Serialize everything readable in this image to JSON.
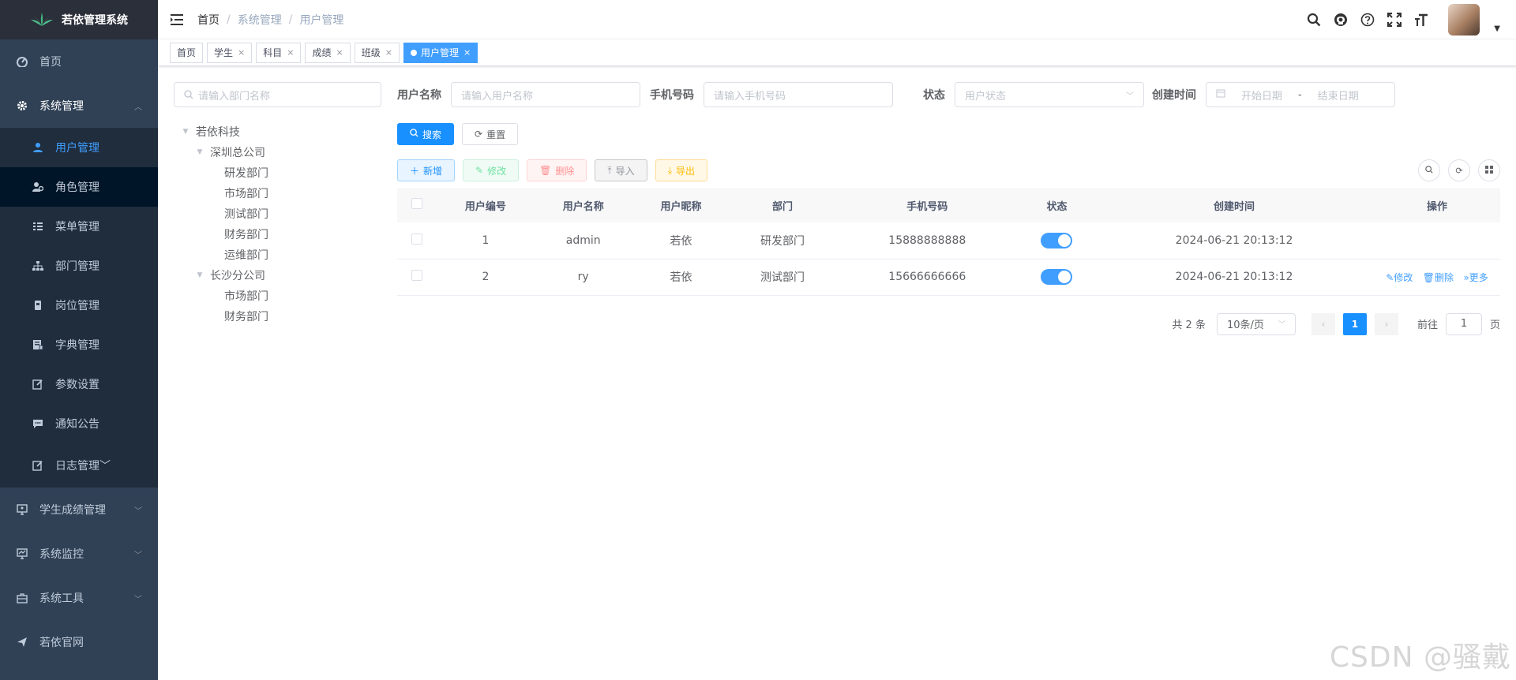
{
  "app": {
    "title": "若依管理系统"
  },
  "sidebar": {
    "items": [
      {
        "label": "首页",
        "icon": "dashboard-icon"
      },
      {
        "label": "系统管理",
        "icon": "gear-icon",
        "expanded": true,
        "children": [
          {
            "label": "用户管理",
            "icon": "user-icon",
            "active": true
          },
          {
            "label": "角色管理",
            "icon": "role-icon"
          },
          {
            "label": "菜单管理",
            "icon": "menu-list-icon"
          },
          {
            "label": "部门管理",
            "icon": "tree-icon"
          },
          {
            "label": "岗位管理",
            "icon": "post-icon"
          },
          {
            "label": "字典管理",
            "icon": "dict-icon"
          },
          {
            "label": "参数设置",
            "icon": "edit-icon"
          },
          {
            "label": "通知公告",
            "icon": "message-icon"
          },
          {
            "label": "日志管理",
            "icon": "log-icon"
          }
        ]
      },
      {
        "label": "学生成绩管理",
        "icon": "monitor-icon"
      },
      {
        "label": "系统监控",
        "icon": "chart-icon"
      },
      {
        "label": "系统工具",
        "icon": "toolbox-icon"
      },
      {
        "label": "若依官网",
        "icon": "send-icon"
      }
    ]
  },
  "breadcrumb": [
    "首页",
    "系统管理",
    "用户管理"
  ],
  "tags": [
    {
      "label": "首页",
      "closable": false
    },
    {
      "label": "学生",
      "closable": true
    },
    {
      "label": "科目",
      "closable": true
    },
    {
      "label": "成绩",
      "closable": true
    },
    {
      "label": "班级",
      "closable": true
    },
    {
      "label": "用户管理",
      "closable": true,
      "active": true
    }
  ],
  "dept_search": {
    "placeholder": "请输入部门名称"
  },
  "dept_tree": {
    "root": "若依科技",
    "children": [
      {
        "label": "深圳总公司",
        "children": [
          "研发部门",
          "市场部门",
          "测试部门",
          "财务部门",
          "运维部门"
        ]
      },
      {
        "label": "长沙分公司",
        "children": [
          "市场部门",
          "财务部门"
        ]
      }
    ]
  },
  "search_form": {
    "username_label": "用户名称",
    "username_placeholder": "请输入用户名称",
    "phone_label": "手机号码",
    "phone_placeholder": "请输入手机号码",
    "status_label": "状态",
    "status_placeholder": "用户状态",
    "created_label": "创建时间",
    "start_placeholder": "开始日期",
    "range_sep": "-",
    "end_placeholder": "结束日期",
    "search_btn": "搜索",
    "reset_btn": "重置"
  },
  "toolbar": {
    "add": "新增",
    "edit": "修改",
    "delete": "删除",
    "import": "导入",
    "export": "导出"
  },
  "table": {
    "columns": [
      "用户编号",
      "用户名称",
      "用户昵称",
      "部门",
      "手机号码",
      "状态",
      "创建时间",
      "操作"
    ],
    "rows": [
      {
        "id": "1",
        "username": "admin",
        "nickname": "若依",
        "dept": "研发部门",
        "phone": "15888888888",
        "status_on": true,
        "created": "2024-06-21 20:13:12",
        "ops": []
      },
      {
        "id": "2",
        "username": "ry",
        "nickname": "若依",
        "dept": "测试部门",
        "phone": "15666666666",
        "status_on": true,
        "created": "2024-06-21 20:13:12",
        "ops": [
          "修改",
          "删除",
          "更多"
        ]
      }
    ]
  },
  "pagination": {
    "total_text": "共 2 条",
    "page_size": "10条/页",
    "current_page": "1",
    "goto_label": "前往",
    "goto_value": "1",
    "page_suffix": "页"
  },
  "watermark": "CSDN @骚戴",
  "colors": {
    "sidebar_bg": "#304156",
    "accent": "#1890ff",
    "active_menu": "#409eff"
  }
}
